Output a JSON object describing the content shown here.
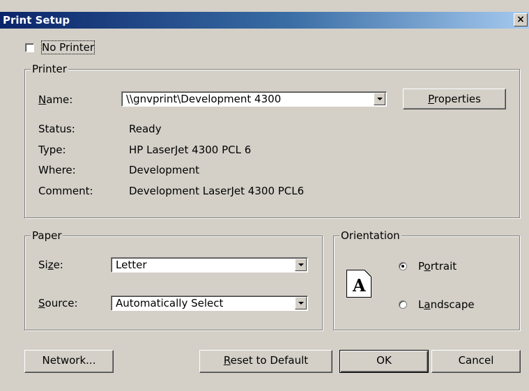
{
  "window": {
    "title": "Print Setup",
    "close_glyph": "×"
  },
  "no_printer": {
    "label": "No Printer",
    "checked": false
  },
  "printer": {
    "legend": "Printer",
    "name_label_pre": "",
    "name_label_ul": "N",
    "name_label_post": "ame:",
    "name_value": "\\\\gnvprint\\Development 4300",
    "properties_pre": "",
    "properties_ul": "P",
    "properties_post": "roperties",
    "status_label": "Status:",
    "status_value": "Ready",
    "type_label": "Type:",
    "type_value": "HP LaserJet 4300 PCL 6",
    "where_label": "Where:",
    "where_value": "Development",
    "comment_label": "Comment:",
    "comment_value": "Development LaserJet 4300 PCL6"
  },
  "paper": {
    "legend": "Paper",
    "size_pre": "Si",
    "size_ul": "z",
    "size_post": "e:",
    "size_value": "Letter",
    "source_pre": "",
    "source_ul": "S",
    "source_post": "ource:",
    "source_value": "Automatically Select"
  },
  "orientation": {
    "legend": "Orientation",
    "icon_letter": "A",
    "portrait_pre": "P",
    "portrait_ul": "o",
    "portrait_post": "rtrait",
    "landscape_pre": "L",
    "landscape_ul": "a",
    "landscape_post": "ndscape",
    "selected": "portrait"
  },
  "buttons": {
    "network": "Network...",
    "reset_pre": "",
    "reset_ul": "R",
    "reset_post": "eset to Default",
    "ok": "OK",
    "cancel": "Cancel"
  }
}
